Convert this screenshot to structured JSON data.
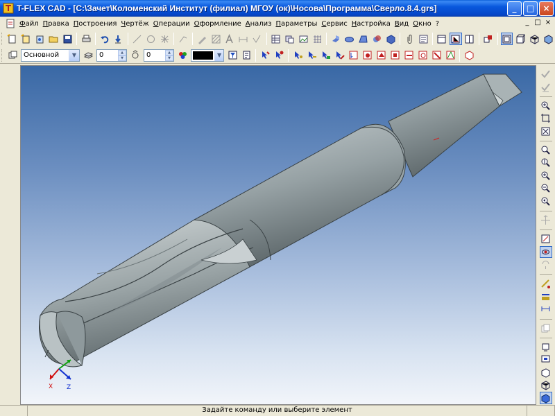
{
  "window": {
    "title": "T-FLEX CAD - [C:\\Зачет\\Коломенский Институт (филиал) МГОУ (ок)\\Носова\\Программа\\Сверло.8.4.grs]",
    "controls": [
      "_",
      "□",
      "×"
    ]
  },
  "menu": {
    "items": [
      "Файл",
      "Правка",
      "Построения",
      "Чертёж",
      "Операции",
      "Оформление",
      "Анализ",
      "Параметры",
      "Сервис",
      "Настройка",
      "Вид",
      "Окно",
      "?"
    ],
    "mdi_controls": [
      "_",
      "□",
      "×"
    ]
  },
  "toolbar2": {
    "layer_value": "Основной",
    "level_value": "0",
    "priority_value": "0"
  },
  "viewport": {
    "axis_labels": {
      "x": "X",
      "z": "Z"
    },
    "colors": {
      "axis_x": "#d01010",
      "axis_y": "#10a010",
      "axis_z": "#1030d0",
      "model": "#8a9396"
    }
  },
  "status": {
    "left": "",
    "message": "Задайте команду или выберите элемент",
    "right": ""
  }
}
